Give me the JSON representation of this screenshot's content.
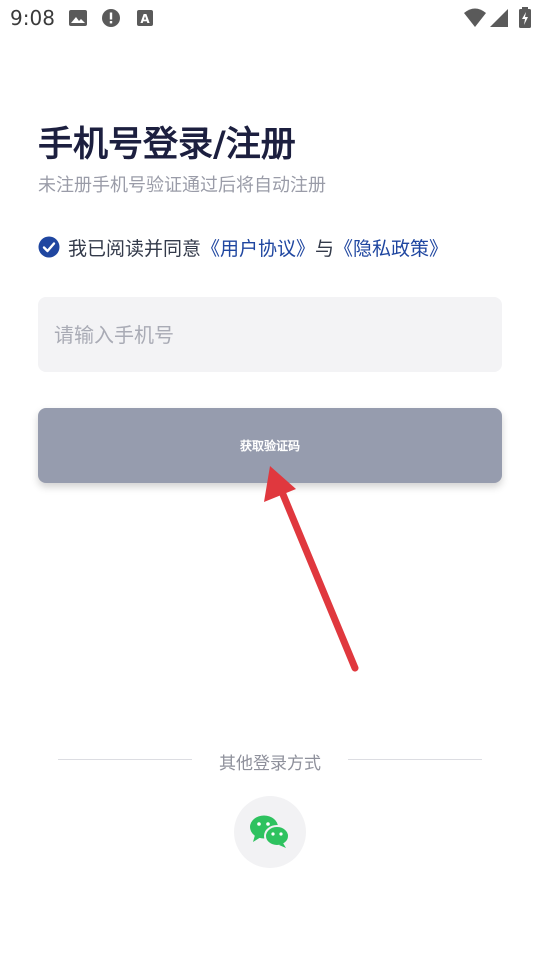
{
  "status_bar": {
    "time": "9:08",
    "icons": [
      "gallery-icon",
      "alert-icon",
      "a-icon",
      "wifi-icon",
      "signal-icon",
      "battery-charging-icon"
    ]
  },
  "header": {
    "title": "手机号登录/注册",
    "subtitle": "未注册手机号验证通过后将自动注册"
  },
  "agreement": {
    "checked": true,
    "prefix": "我已阅读并同意",
    "user_agreement": "《用户协议》",
    "joiner": "与",
    "privacy_policy": "《隐私政策》"
  },
  "phone": {
    "value": "",
    "placeholder": "请输入手机号"
  },
  "code_button": {
    "label": "获取验证码"
  },
  "other_login": {
    "label": "其他登录方式",
    "methods": [
      "wechat-icon"
    ]
  },
  "colors": {
    "title": "#1c1f3f",
    "link": "#1f46a0",
    "checkbox": "#1f46a0",
    "button_disabled": "#969cae",
    "input_bg": "#f3f3f5",
    "annotation_arrow": "#e0383e",
    "wechat": "#2ec25f"
  }
}
